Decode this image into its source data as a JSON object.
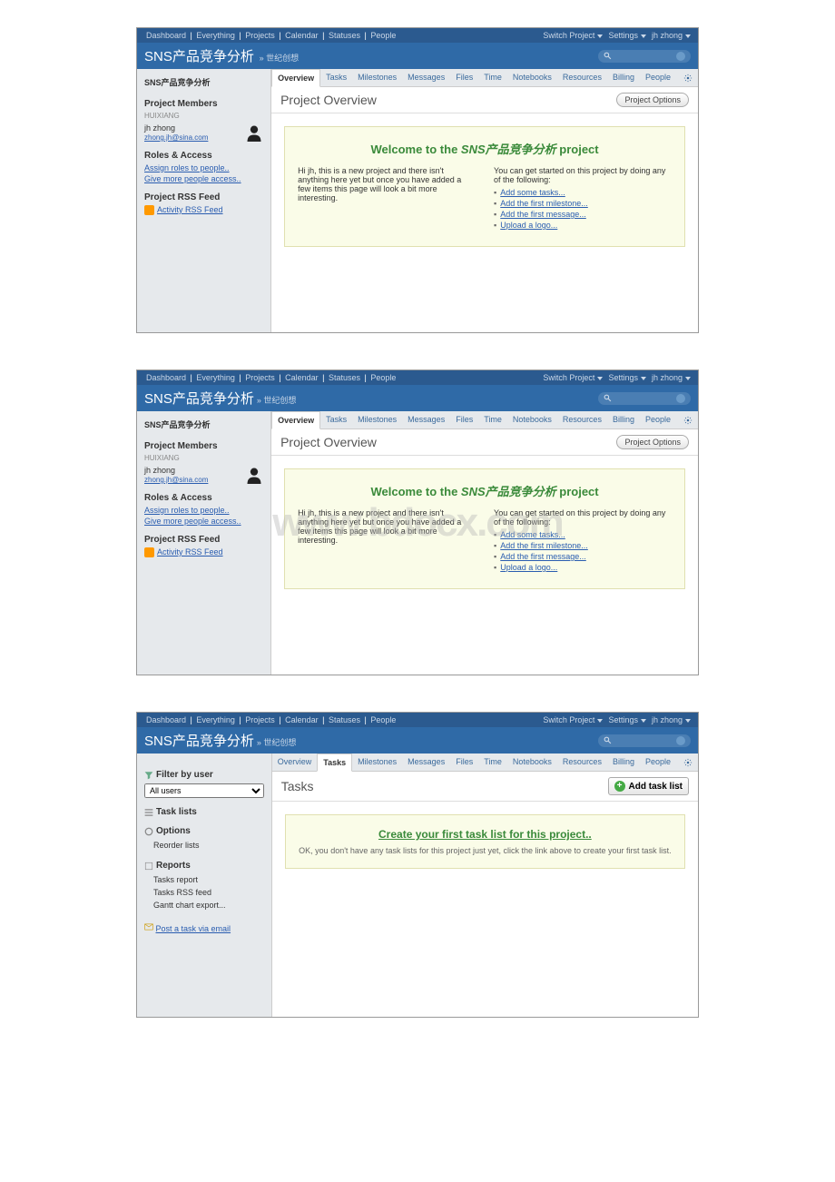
{
  "nav": {
    "items": [
      "Dashboard",
      "Everything",
      "Projects",
      "Calendar",
      "Statuses",
      "People"
    ],
    "switch": "Switch Project",
    "settings": "Settings",
    "user": "jh zhong"
  },
  "project": {
    "title": "SNS产品竞争分析",
    "sub": "» 世纪创想"
  },
  "tabs": [
    "Overview",
    "Tasks",
    "Milestones",
    "Messages",
    "Files",
    "Time",
    "Notebooks",
    "Resources",
    "Billing",
    "People"
  ],
  "overview": {
    "heading": "Project Overview",
    "optionsBtn": "Project Options",
    "sidebarName": "SNS产品竞争分析",
    "membersLabel": "Project Members",
    "company": "HUIXIANG",
    "memberName": "jh zhong",
    "memberEmail": "zhong.jh@sina.com",
    "rolesLabel": "Roles & Access",
    "assignRoles": "Assign roles to people..",
    "givePeople": "Give more people access..",
    "rssLabel": "Project RSS Feed",
    "rssLink": "Activity RSS Feed",
    "welcomePrefix": "Welcome to the ",
    "welcomeProject": "SNS产品竞争分析",
    "welcomeSuffix": " project",
    "leftPara": "Hi jh, this is a new project and there isn't anything here yet but once you have added a few items this page will look a bit more interesting.",
    "rightIntro": "You can get started on this project by doing any of the following:",
    "actions": [
      "Add some tasks...",
      "Add the first milestone...",
      "Add the first message...",
      "Upload a logo..."
    ]
  },
  "tasks": {
    "heading": "Tasks",
    "addBtn": "Add task list",
    "filterLabel": "Filter by user",
    "filterValue": "All users",
    "taskListsLabel": "Task lists",
    "optionsLabel": "Options",
    "reorder": "Reorder lists",
    "reportsLabel": "Reports",
    "tasksReport": "Tasks report",
    "tasksRss": "Tasks RSS feed",
    "gantt": "Gantt chart export...",
    "postEmail": "Post a task via email",
    "createFirst": "Create your first task list for this project..",
    "createDesc": "OK, you don't have any task lists for this project just yet, click the link above to create your first task list."
  },
  "watermark": "www.bdocx.com"
}
